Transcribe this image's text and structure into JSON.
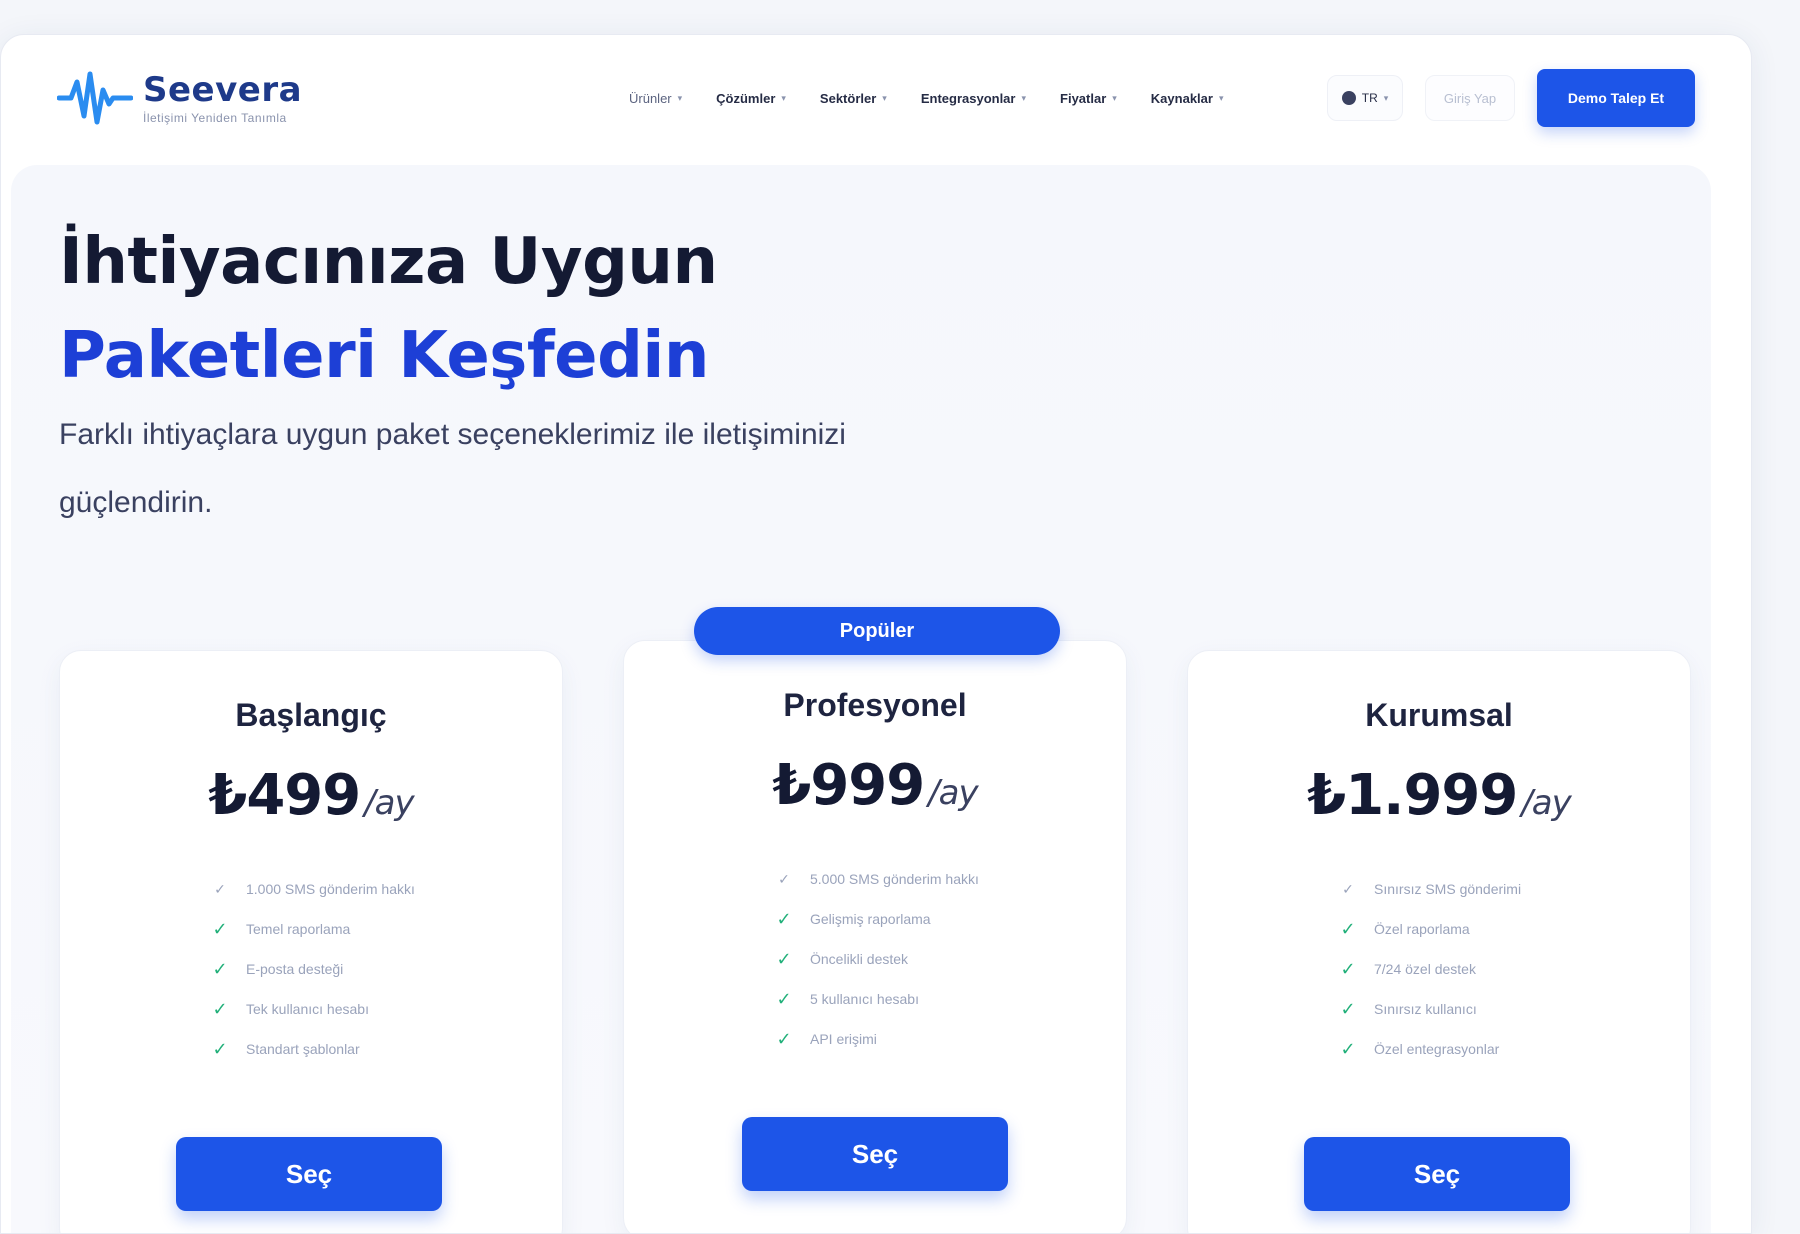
{
  "brand": {
    "name": "Seevera",
    "tagline": "İletişimi Yeniden Tanımla"
  },
  "nav": [
    {
      "label": "Ürünler",
      "muted": true
    },
    {
      "label": "Çözümler",
      "muted": false
    },
    {
      "label": "Sektörler",
      "muted": false
    },
    {
      "label": "Entegrasyonlar",
      "muted": false
    },
    {
      "label": "Fiyatlar",
      "muted": false
    },
    {
      "label": "Kaynaklar",
      "muted": false
    }
  ],
  "header": {
    "language": "TR",
    "login_label": "Giriş Yap",
    "cta_label": "Demo Talep Et"
  },
  "hero": {
    "title_line1": "İhtiyacınıza Uygun",
    "title_line2": "Paketleri Keşfedin",
    "subtitle": "Farklı ihtiyaçlara uygun paket seçeneklerimiz ile iletişiminizi güçlendirin."
  },
  "plans": [
    {
      "name": "Başlangıç",
      "price": "₺499",
      "period": "/ay",
      "badge": "",
      "features": [
        "1.000 SMS gönderim hakkı",
        "Temel raporlama",
        "E-posta desteği",
        "Tek kullanıcı hesabı",
        "Standart şablonlar"
      ],
      "button": "Seç"
    },
    {
      "name": "Profesyonel",
      "price": "₺999",
      "period": "/ay",
      "badge": "Popüler",
      "features": [
        "5.000 SMS gönderim hakkı",
        "Gelişmiş raporlama",
        "Öncelikli destek",
        "5 kullanıcı hesabı",
        "API erişimi"
      ],
      "button": "Seç"
    },
    {
      "name": "Kurumsal",
      "price": "₺1.999",
      "period": "/ay",
      "badge": "",
      "features": [
        "Sınırsız SMS gönderimi",
        "Özel raporlama",
        "7/24 özel destek",
        "Sınırsız kullanıcı",
        "Özel entegrasyonlar"
      ],
      "button": "Seç"
    }
  ],
  "colors": {
    "primary": "#1d55e8",
    "accent_text": "#1d3fd6",
    "check": "#22b07a",
    "heading": "#141a33"
  },
  "icons": {
    "logo": "sound-wave-icon",
    "globe": "globe-icon",
    "chevron": "chevron-down-icon",
    "check": "check-icon"
  }
}
